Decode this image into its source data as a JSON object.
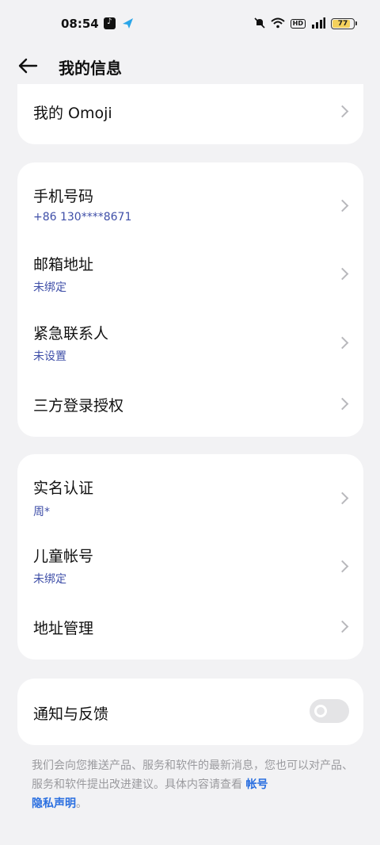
{
  "status_bar": {
    "time": "08:54",
    "battery_level": 77,
    "battery_label": "77",
    "hd_label": "HD",
    "icons": [
      "tiktok-icon",
      "plane-app-icon",
      "mute-icon",
      "wifi-icon",
      "hd-icon",
      "signal-icon",
      "battery-icon"
    ]
  },
  "header": {
    "title": "我的信息",
    "back_icon": "back-arrow-icon"
  },
  "card_omoji": {
    "label": "我的 Omoji"
  },
  "card_contact": {
    "phone": {
      "label": "手机号码",
      "value": "+86 130****8671"
    },
    "email": {
      "label": "邮箱地址",
      "value": "未绑定"
    },
    "emergency": {
      "label": "紧急联系人",
      "value": "未设置"
    },
    "third_party": {
      "label": "三方登录授权"
    }
  },
  "card_identity": {
    "realname": {
      "label": "实名认证",
      "value": "周*"
    },
    "child": {
      "label": "儿童帐号",
      "value": "未绑定"
    },
    "address": {
      "label": "地址管理"
    }
  },
  "card_notify": {
    "label": "通知与反馈",
    "enabled": false
  },
  "footnote": {
    "text": "我们会向您推送产品、服务和软件的最新消息，您也可以对产品、服务和软件提出改进建议。具体内容请查看 ",
    "link_account": "帐号",
    "link_privacy": "隐私声明",
    "end": "。"
  },
  "colors": {
    "background": "#f2f2f4",
    "card": "#ffffff",
    "subtext": "#3f4fa8",
    "link": "#2a6fe0"
  }
}
